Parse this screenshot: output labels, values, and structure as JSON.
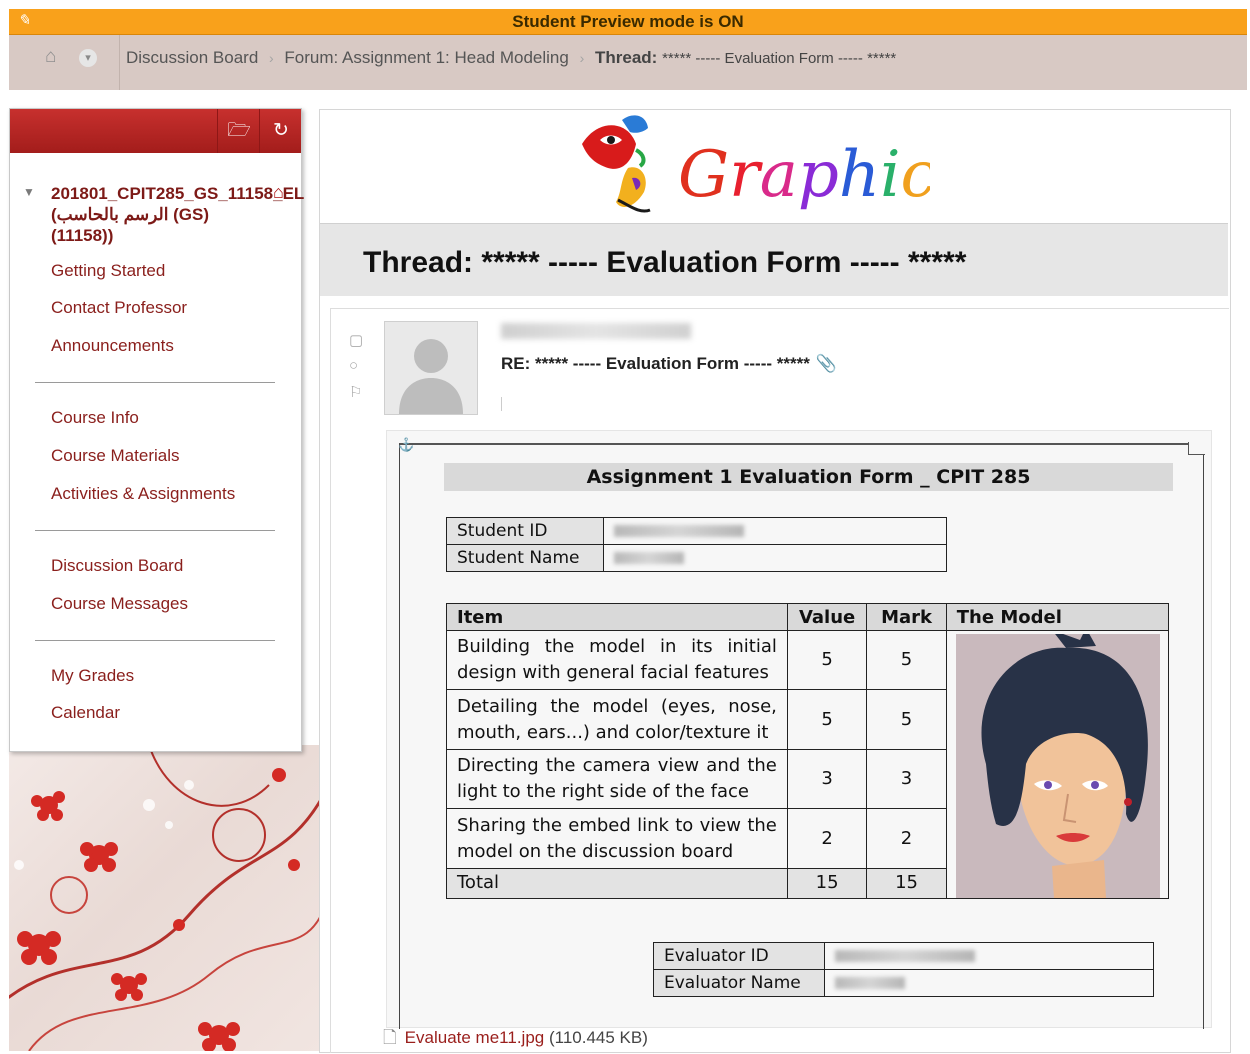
{
  "banner": {
    "title": "Student Preview mode is ON"
  },
  "breadcrumb": {
    "items": [
      "Discussion Board",
      "Forum: Assignment 1: Head Modeling"
    ],
    "current_prefix": "Thread:",
    "current_rest": "***** ----- Evaluation Form ----- *****"
  },
  "sidebar": {
    "course_title": "201801_CPIT285_GS_11158_EL (الرسم بالحاسب (GS) (11158))",
    "groups": [
      [
        "Getting Started",
        "Contact Professor",
        "Announcements"
      ],
      [
        "Course Info",
        "Course Materials",
        "Activities & Assignments"
      ],
      [
        "Discussion Board",
        "Course Messages"
      ],
      [
        "My Grades",
        "Calendar"
      ]
    ]
  },
  "logo": {
    "text": "Graphics"
  },
  "thread": {
    "title": "Thread: ***** ----- Evaluation Form ----- *****"
  },
  "post": {
    "subject": "RE: ***** ----- Evaluation Form ----- *****"
  },
  "form": {
    "title": "Assignment 1 Evaluation Form _ CPIT 285",
    "student_id_label": "Student ID",
    "student_name_label": "Student Name",
    "headers": {
      "item": "Item",
      "value": "Value",
      "mark": "Mark",
      "model": "The Model"
    },
    "rows": [
      {
        "item": "Building the model in its initial design with general facial features",
        "value": "5",
        "mark": "5"
      },
      {
        "item": "Detailing the model (eyes, nose, mouth, ears...) and color/texture it",
        "value": "5",
        "mark": "5"
      },
      {
        "item": "Directing the camera view and the light to the right side of the face",
        "value": "3",
        "mark": "3"
      },
      {
        "item": "Sharing the embed link to view the model on the discussion board",
        "value": "2",
        "mark": "2"
      }
    ],
    "total": {
      "label": "Total",
      "value": "15",
      "mark": "15"
    },
    "evaluator_id_label": "Evaluator ID",
    "evaluator_name_label": "Evaluator Name"
  },
  "attachment": {
    "filename": "Evaluate me11.jpg",
    "size": "(110.445 KB)"
  },
  "colors": {
    "banner": "#f9a11b",
    "sidebar_header": "#b52624",
    "link": "#8a1f1c"
  }
}
